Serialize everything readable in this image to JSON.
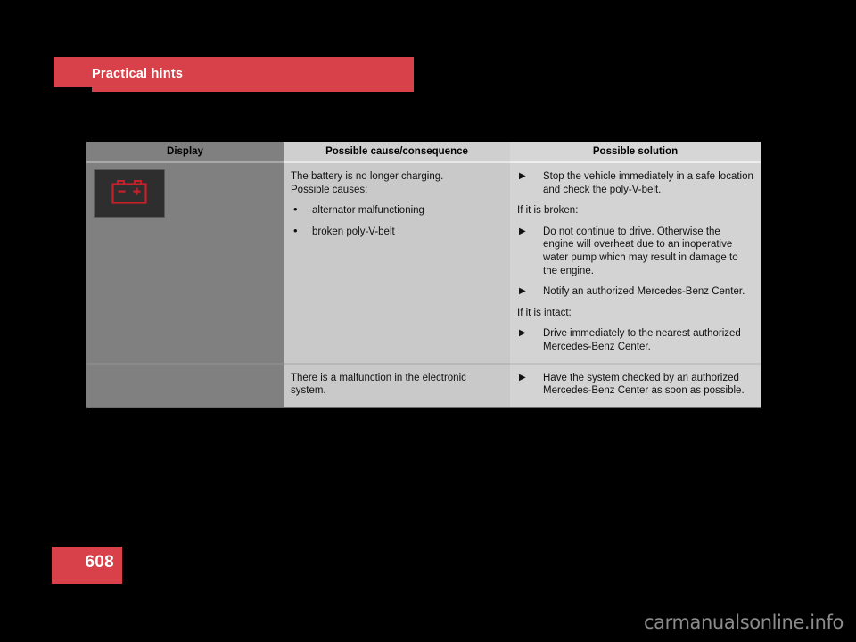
{
  "section": {
    "title": "Practical hints"
  },
  "page": {
    "number": "608",
    "watermark": "carmanualsonline.info"
  },
  "colors": {
    "accent_red": "#d8404a",
    "icon_red": "#c8202a",
    "display_column_bg": "#808080",
    "cause_column_bg": "#c9c9c9",
    "solution_column_bg": "#d3d3d3",
    "header_display_bg": "#808080",
    "header_cell_bg": "#cfcfcf",
    "icon_panel_bg": "#2e2e2e"
  },
  "table": {
    "headers": {
      "display": "Display",
      "cause": "Possible cause/consequence",
      "solution": "Possible solution"
    },
    "rows": [
      {
        "icon": "battery-warning-icon",
        "cause": {
          "intro_line_1": "The battery is no longer charging.",
          "intro_line_2": "Possible causes:",
          "bullets": [
            "alternator malfunctioning",
            "broken poly-V-belt"
          ]
        },
        "solution": {
          "steps_1": [
            "Stop the vehicle immediately in a safe location and check the poly-V-belt."
          ],
          "condition_1": "If it is broken:",
          "steps_2": [
            "Do not continue to drive. Otherwise the engine will overheat due to an inoperative water pump which may result in damage to the engine.",
            "Notify an authorized Mercedes-Benz Center."
          ],
          "condition_2": "If it is intact:",
          "steps_3": [
            "Drive immediately to the nearest authorized Mercedes-Benz Center."
          ]
        }
      },
      {
        "icon": null,
        "cause": {
          "text": "There is a malfunction in the electronic system."
        },
        "solution": {
          "steps_1": [
            "Have the system checked by an authorized Mercedes-Benz Center as soon as possible."
          ]
        }
      }
    ]
  },
  "markers": {
    "dot": "•",
    "triangle": "▶"
  }
}
